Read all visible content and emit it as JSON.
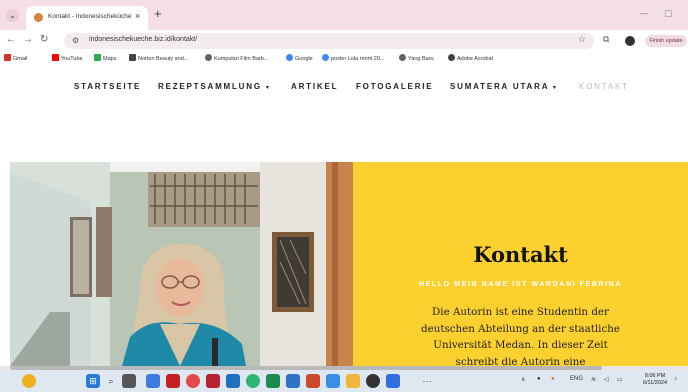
{
  "browser": {
    "tab_title": "Kontakt - Indonesischeküche",
    "new_tab_label": "+",
    "url": "indonesischekueche.biz.id/kontakt/",
    "finish_update_label": "Finish update",
    "bookmarks": [
      {
        "label": "Gmail",
        "icon": "gmail-icon",
        "color": "#d93025"
      },
      {
        "label": "YouTube",
        "icon": "youtube-icon",
        "color": "#ff0000"
      },
      {
        "label": "Maps",
        "icon": "maps-icon",
        "color": "#34a853"
      },
      {
        "label": "Norton Beauty and...",
        "icon": "bookmark-icon",
        "color": "#444444"
      },
      {
        "label": "Kumpulan Film Barb...",
        "icon": "globe-icon",
        "color": "#5f6368"
      },
      {
        "label": "Google",
        "icon": "google-icon",
        "color": "#4285f4"
      },
      {
        "label": "poster Lola rennt 20...",
        "icon": "google-icon",
        "color": "#4285f4"
      },
      {
        "label": "Yang Baru",
        "icon": "globe-icon",
        "color": "#5f6368"
      },
      {
        "label": "Adobe Acrobat",
        "icon": "acrobat-icon",
        "color": "#444444"
      }
    ]
  },
  "site": {
    "nav": [
      {
        "label": "STARTSEITE",
        "dropdown": false,
        "active": false
      },
      {
        "label": "REZEPTSAMMLUNG",
        "dropdown": true,
        "active": false
      },
      {
        "label": "ARTIKEL",
        "dropdown": false,
        "active": false
      },
      {
        "label": "FOTOGALERIE",
        "dropdown": false,
        "active": false
      },
      {
        "label": "SUMATERA UTARA",
        "dropdown": true,
        "active": false
      },
      {
        "label": "KONTAKT",
        "dropdown": false,
        "active": true
      }
    ],
    "hero": {
      "title": "Kontakt",
      "subtitle": "HELLO MEIN NAME IST WARDANI FEBRINA",
      "body": "Die Autorin ist eine Studentin der deutschen Abteilung an der staatliche Universität Medan. In dieser Zeit schreibt die Autorin eine",
      "accent_color": "#fcd02f"
    }
  },
  "taskbar": {
    "lang": "ENG",
    "time": "8:06 PM",
    "date": "6/11/2024"
  }
}
